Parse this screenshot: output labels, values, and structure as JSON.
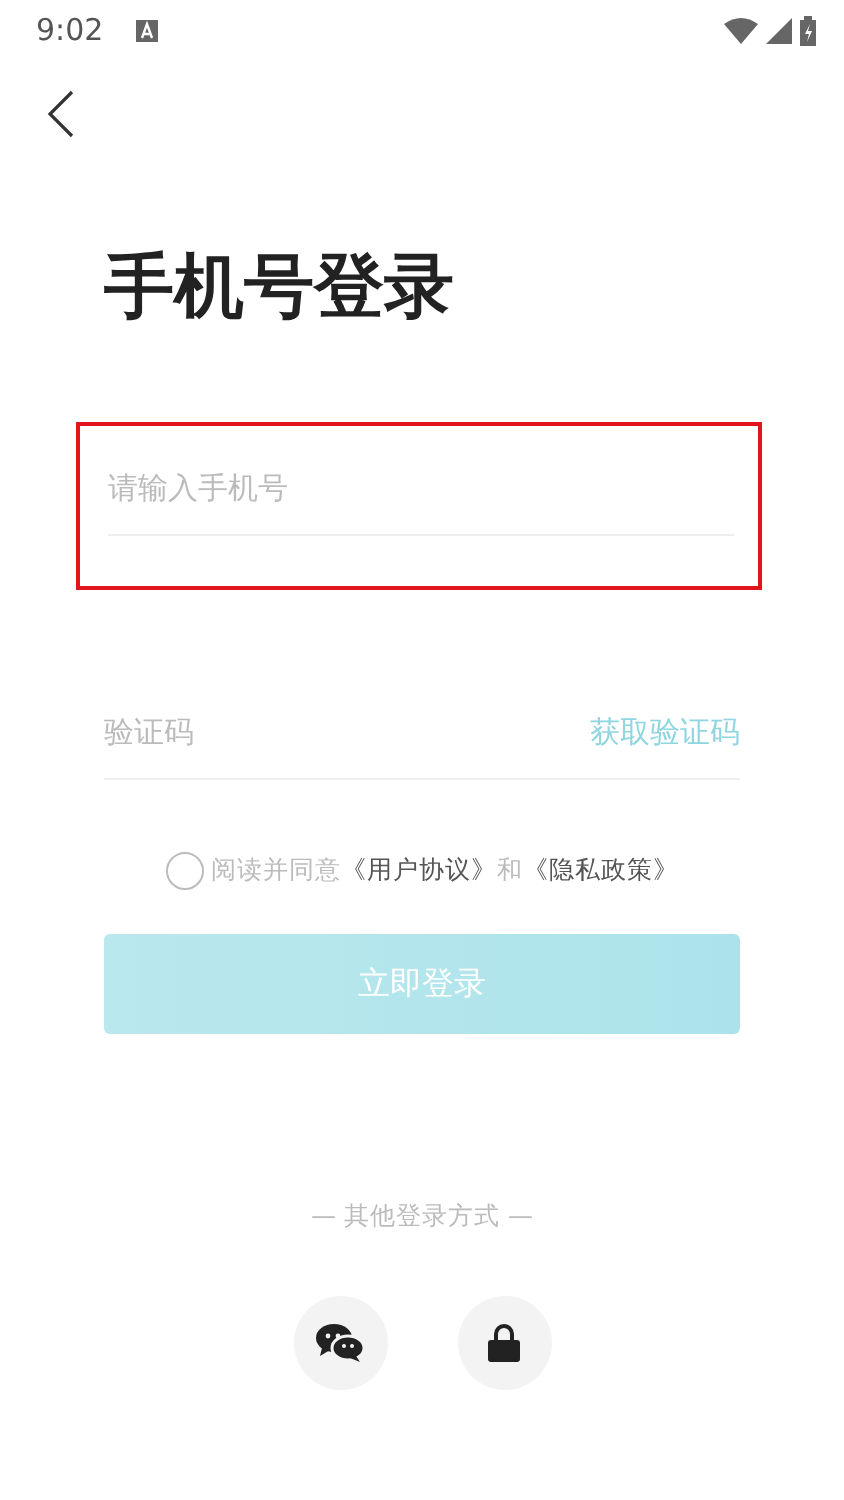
{
  "status_bar": {
    "time": "9:02"
  },
  "title": "手机号登录",
  "phone_field": {
    "placeholder": "请输入手机号",
    "highlighted": true
  },
  "code_field": {
    "placeholder": "验证码",
    "action": "获取验证码"
  },
  "agreement": {
    "checked": false,
    "prefix": "阅读并同意",
    "link_1": "《用户协议》",
    "joiner": "和",
    "link_2": "《隐私政策》"
  },
  "login_button": {
    "label": "立即登录",
    "disabled": true
  },
  "other_login": {
    "label": "— 其他登录方式 —",
    "options": [
      {
        "kind": "chat"
      },
      {
        "kind": "lock"
      }
    ]
  }
}
